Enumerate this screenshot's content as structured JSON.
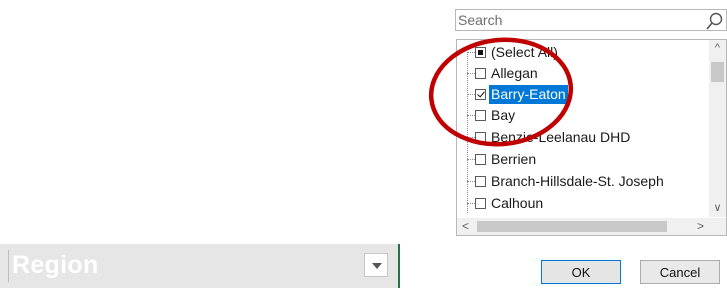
{
  "search": {
    "placeholder": "Search"
  },
  "list": {
    "items": [
      {
        "label": "(Select All)",
        "state": "partial"
      },
      {
        "label": "Allegan",
        "state": "unchecked"
      },
      {
        "label": "Barry-Eaton",
        "state": "checked",
        "selected": true
      },
      {
        "label": "Bay",
        "state": "unchecked"
      },
      {
        "label": "Benzie-Leelanau DHD",
        "state": "unchecked"
      },
      {
        "label": "Berrien",
        "state": "unchecked"
      },
      {
        "label": "Branch-Hillsdale-St. Joseph",
        "state": "unchecked"
      },
      {
        "label": "Calhoun",
        "state": "unchecked"
      }
    ]
  },
  "buttons": {
    "ok": "OK",
    "cancel": "Cancel"
  },
  "header": {
    "region_label": "Region"
  },
  "colors": {
    "selection": "#0078d7",
    "annotation": "#c00000",
    "excel_green": "#217346"
  },
  "icons": {
    "search": "search-icon",
    "scroll_up": "chevron-up-icon",
    "scroll_down": "chevron-down-icon",
    "scroll_left": "chevron-left-icon",
    "scroll_right": "chevron-right-icon",
    "filter": "dropdown-arrow-icon"
  }
}
